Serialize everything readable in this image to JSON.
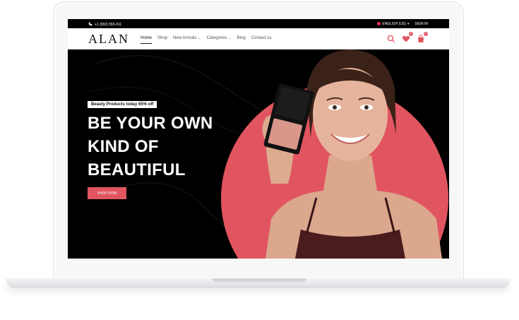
{
  "topbar": {
    "phone": "+1 (650) 555-011",
    "language": "ENGLISH (US)",
    "signin": "SIGN IN"
  },
  "brand": {
    "logo": "ALAN"
  },
  "nav": {
    "items": [
      {
        "label": "Home",
        "active": true
      },
      {
        "label": "Shop"
      },
      {
        "label": "New Arrivals",
        "dropdown": true
      },
      {
        "label": "Categories",
        "dropdown": true
      },
      {
        "label": "Blog"
      },
      {
        "label": "Contact us"
      }
    ]
  },
  "header_icons": {
    "wishlist_count": "0",
    "cart_count": "0"
  },
  "hero": {
    "promo": "Beauty Products today 65% off",
    "headline_lines": [
      "BE YOUR OWN",
      "KIND OF",
      "BEAUTIFUL"
    ],
    "cta": "SHOP NOW"
  },
  "colors": {
    "accent": "#e15560",
    "background": "#000000"
  }
}
